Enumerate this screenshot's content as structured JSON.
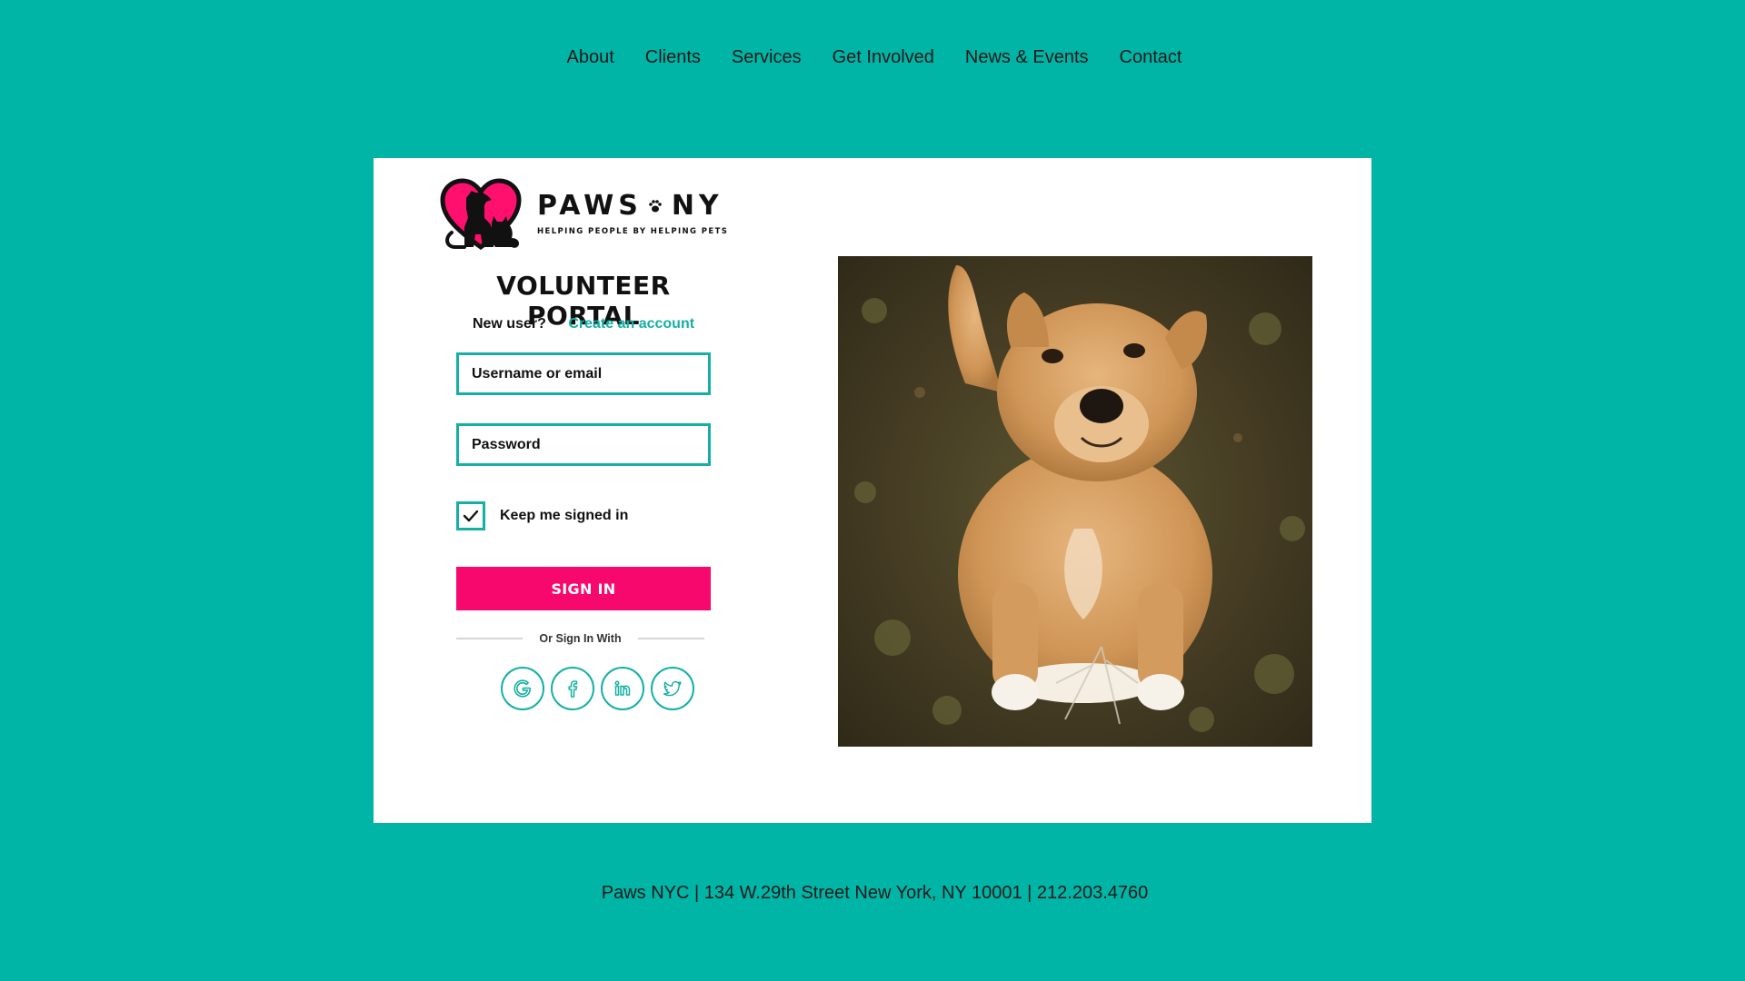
{
  "nav": {
    "items": [
      {
        "label": "About"
      },
      {
        "label": "Clients"
      },
      {
        "label": "Services"
      },
      {
        "label": "Get Involved"
      },
      {
        "label": "News & Events"
      },
      {
        "label": "Contact"
      }
    ]
  },
  "logo": {
    "name_left": "PAWS",
    "name_right": "NY",
    "tagline": "HELPING PEOPLE BY HELPING PETS",
    "icon": "heart-dog-cat-icon",
    "brand_color": "#FF0F6E"
  },
  "login": {
    "title": "VOLUNTEER PORTAL",
    "new_user_text": "New user?",
    "create_account_label": "Create an account",
    "username_placeholder": "Username or email",
    "password_placeholder": "Password",
    "keep_signed_in_label": "Keep me signed in",
    "keep_signed_in_checked": true,
    "sign_in_label": "SIGN IN",
    "or_sign_in_with": "Or Sign In With",
    "social": [
      {
        "icon": "google-icon"
      },
      {
        "icon": "facebook-icon"
      },
      {
        "icon": "linkedin-icon"
      },
      {
        "icon": "twitter-icon"
      }
    ]
  },
  "photo": {
    "subject": "dog-photo"
  },
  "footer": {
    "text": "Paws NYC | 134 W.29th Street  New York, NY 10001 | 212.203.4760"
  },
  "colors": {
    "background": "#00B4A6",
    "accent": "#14B0A4",
    "primary_button": "#F7086D",
    "card": "#FFFFFF"
  }
}
